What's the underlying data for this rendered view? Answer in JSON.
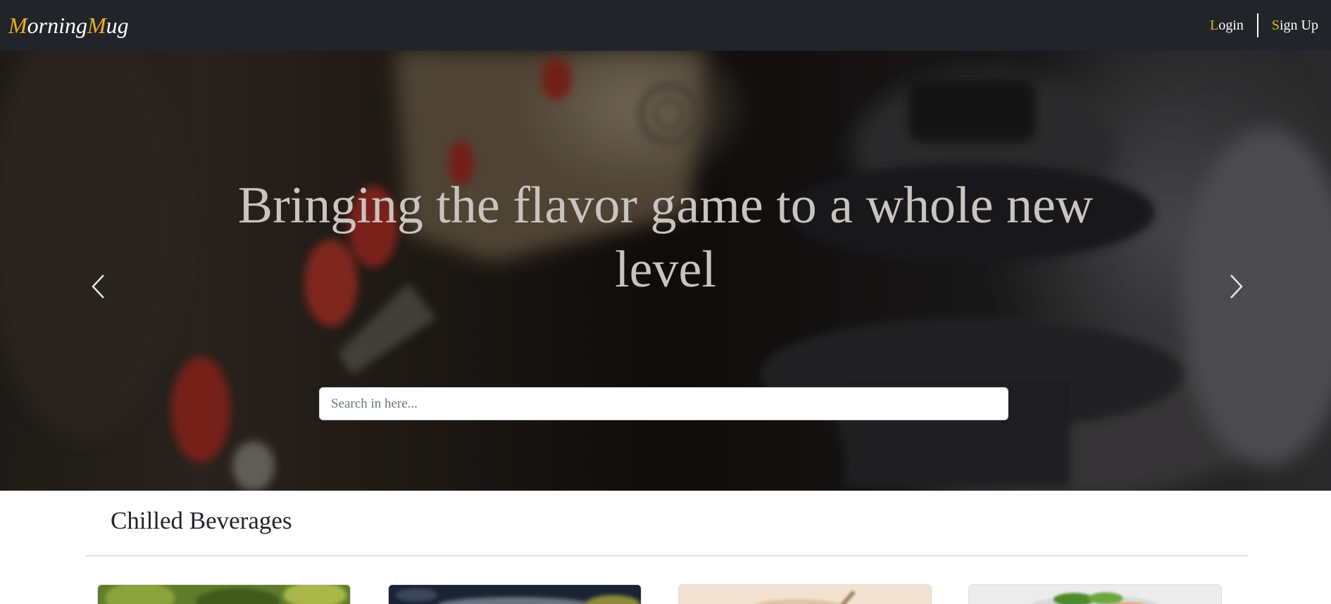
{
  "navbar": {
    "brand": {
      "first_initial": "M",
      "first_rest": "orning",
      "second_initial": "M",
      "second_rest": "ug"
    },
    "login": {
      "initial": "L",
      "rest": "ogin"
    },
    "signup": {
      "initial": "S",
      "rest": "ign Up"
    }
  },
  "hero": {
    "headline": "Bringing the flavor game to a whole new level",
    "search": {
      "placeholder": "Search in here...",
      "value": ""
    },
    "prev_icon": "chevron-left-icon",
    "next_icon": "chevron-right-icon"
  },
  "section": {
    "title": "Chilled Beverages",
    "cards": [
      {
        "image": "green-leafy-drink-image"
      },
      {
        "image": "dark-glass-drink-image"
      },
      {
        "image": "cream-coffee-drink-image"
      },
      {
        "image": "mint-garnish-drink-image"
      }
    ]
  },
  "colors": {
    "navbar_bg": "#212529",
    "accent": "#f0ad1e",
    "text": "#212529"
  }
}
